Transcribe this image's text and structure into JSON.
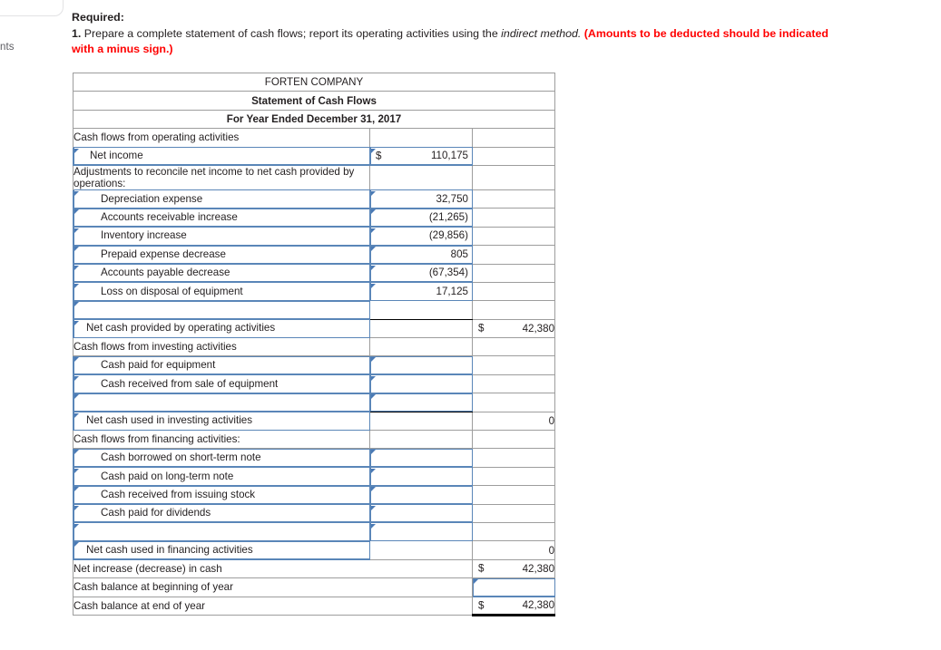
{
  "fragments": {
    "left_text": "nts"
  },
  "prompt": {
    "heading": "Required:",
    "number": "1.",
    "body_a": " Prepare a complete statement of cash flows; report its operating activities using the ",
    "italic": "indirect method.",
    "warning": " (Amounts to be deducted should be indicated with a minus sign.)"
  },
  "colors": {
    "header_blue": "#74aae4",
    "input_border": "#5a86b8",
    "warning_red": "#ff0000",
    "grid": "#9d9d9d"
  },
  "statement": {
    "title_line1": "FORTEN COMPANY",
    "title_line2": "Statement of Cash Flows",
    "title_line3": "For Year Ended December 31, 2017",
    "rows": [
      {
        "label": "Cash flows from operating activities",
        "indent": "lbl",
        "editable_label": false,
        "col2": "",
        "col2_cur": "",
        "col3": "",
        "col3_cur": ""
      },
      {
        "label": "Net income",
        "indent": "i1",
        "editable_label": true,
        "col2": "110,175",
        "col2_cur": "$",
        "col3": "",
        "col3_cur": ""
      },
      {
        "label": "Adjustments to reconcile net income to net cash provided by operations:",
        "indent": "i2",
        "editable_label": false,
        "col2": "",
        "col2_cur": "",
        "col3": "",
        "col3_cur": ""
      },
      {
        "label": "Depreciation expense",
        "indent": "i3",
        "editable_label": true,
        "col2": "32,750",
        "col2_cur": "",
        "col3": "",
        "col3_cur": ""
      },
      {
        "label": "Accounts receivable increase",
        "indent": "i3",
        "editable_label": true,
        "col2": "(21,265)",
        "col2_cur": "",
        "col3": "",
        "col3_cur": ""
      },
      {
        "label": "Inventory increase",
        "indent": "i3",
        "editable_label": true,
        "col2": "(29,856)",
        "col2_cur": "",
        "col3": "",
        "col3_cur": ""
      },
      {
        "label": "Prepaid expense decrease",
        "indent": "i3",
        "editable_label": true,
        "col2": "805",
        "col2_cur": "",
        "col3": "",
        "col3_cur": ""
      },
      {
        "label": "Accounts payable decrease",
        "indent": "i3",
        "editable_label": true,
        "col2": "(67,354)",
        "col2_cur": "",
        "col3": "",
        "col3_cur": ""
      },
      {
        "label": "Loss on disposal of equipment",
        "indent": "i3",
        "editable_label": true,
        "col2": "17,125",
        "col2_cur": "",
        "col3": "",
        "col3_cur": ""
      },
      {
        "label": "",
        "indent": "i3",
        "editable_label": true,
        "col2": "",
        "col2_cur": "",
        "col3": "",
        "col3_cur": "",
        "rule": "col2"
      },
      {
        "label": "Net cash provided by operating activities",
        "indent": "sub",
        "editable_label": true,
        "col2": "",
        "col2_cur": "",
        "col3": "42,380",
        "col3_cur": "$"
      },
      {
        "label": "Cash flows from investing activities",
        "indent": "lbl",
        "editable_label": false,
        "col2": "",
        "col2_cur": "",
        "col3": "",
        "col3_cur": ""
      },
      {
        "label": "Cash paid for equipment",
        "indent": "i3",
        "editable_label": true,
        "col2": "",
        "col2_cur": "",
        "col3": "",
        "col3_cur": "",
        "col2_editable": true
      },
      {
        "label": "Cash received from sale of equipment",
        "indent": "i3",
        "editable_label": true,
        "col2": "",
        "col2_cur": "",
        "col3": "",
        "col3_cur": "",
        "col2_editable": true
      },
      {
        "label": "",
        "indent": "i3",
        "editable_label": true,
        "col2": "",
        "col2_cur": "",
        "col3": "",
        "col3_cur": "",
        "col2_editable": true,
        "rule": "col2"
      },
      {
        "label": "Net cash used in investing activities",
        "indent": "sub",
        "editable_label": true,
        "col2": "",
        "col2_cur": "",
        "col3": "0",
        "col3_cur": ""
      },
      {
        "label": "Cash flows from financing activities:",
        "indent": "lbl",
        "editable_label": false,
        "col2": "",
        "col2_cur": "",
        "col3": "",
        "col3_cur": ""
      },
      {
        "label": "Cash borrowed on short-term note",
        "indent": "i3",
        "editable_label": true,
        "col2": "",
        "col2_cur": "",
        "col3": "",
        "col3_cur": "",
        "col2_editable": true
      },
      {
        "label": "Cash paid on long-term note",
        "indent": "i3",
        "editable_label": true,
        "col2": "",
        "col2_cur": "",
        "col3": "",
        "col3_cur": "",
        "col2_editable": true
      },
      {
        "label": "Cash received from issuing stock",
        "indent": "i3",
        "editable_label": true,
        "col2": "",
        "col2_cur": "",
        "col3": "",
        "col3_cur": "",
        "col2_editable": true
      },
      {
        "label": "Cash paid for dividends",
        "indent": "i3",
        "editable_label": true,
        "col2": "",
        "col2_cur": "",
        "col3": "",
        "col3_cur": "",
        "col2_editable": true
      },
      {
        "label": "",
        "indent": "i3",
        "editable_label": true,
        "col2": "",
        "col2_cur": "",
        "col3": "",
        "col3_cur": "",
        "col2_editable": true,
        "rule": "col2"
      },
      {
        "label": "Net cash used in financing activities",
        "indent": "sub",
        "editable_label": true,
        "col2": "",
        "col2_cur": "",
        "col3": "0",
        "col3_cur": ""
      },
      {
        "label": "Net increase (decrease) in cash",
        "indent": "lbl",
        "editable_label": false,
        "span2": true,
        "col3": "42,380",
        "col3_cur": "$"
      },
      {
        "label": "Cash balance at beginning of year",
        "indent": "lbl",
        "editable_label": false,
        "span2": true,
        "col3": "",
        "col3_cur": "",
        "col3_editable": true
      },
      {
        "label": "Cash balance at end of year",
        "indent": "lbl",
        "editable_label": false,
        "span2": true,
        "col3": "42,380",
        "col3_cur": "$",
        "rule3": "thick"
      }
    ]
  }
}
